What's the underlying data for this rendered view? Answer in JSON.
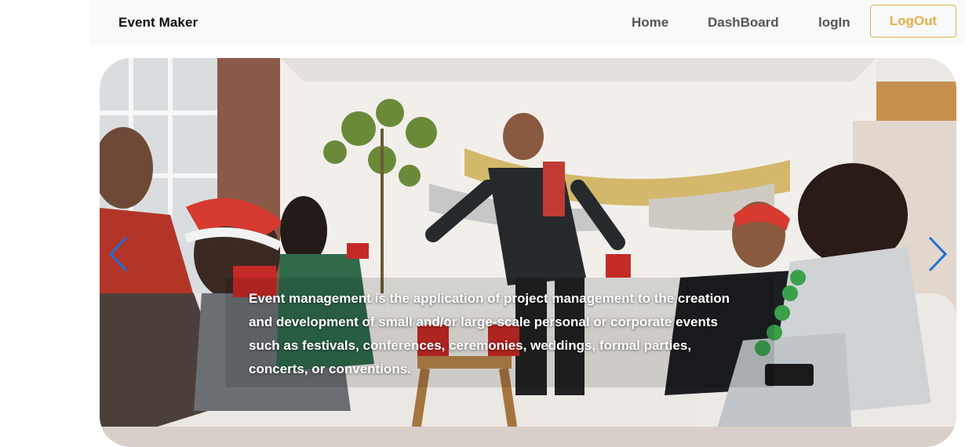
{
  "navbar": {
    "brand": "Event Maker",
    "links": [
      "Home",
      "DashBoard",
      "logIn"
    ],
    "logout_label": "LogOut"
  },
  "carousel": {
    "caption": "Event management is the application of project management to the creation and development of small and/or large-scale personal or corporate events such as festivals, conferences, ceremonies, weddings, formal parties, concerts, or conventions.",
    "prev_icon": "chevron-left-icon",
    "next_icon": "chevron-right-icon"
  },
  "colors": {
    "accent": "#e0b048",
    "nav_bg": "#f8f9fa",
    "control": "#1e6fd9"
  }
}
